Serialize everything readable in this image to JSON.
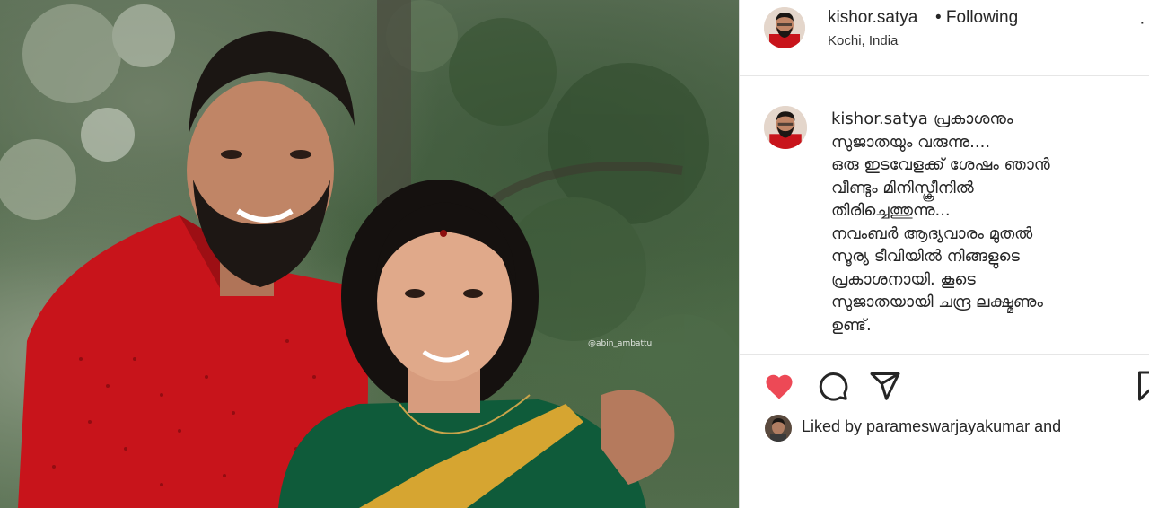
{
  "post": {
    "photo_watermark": "@abin_ambattu"
  },
  "header": {
    "username": "kishor.satya",
    "follow_status": "• Following",
    "location": "Kochi, India",
    "more_icon": "more-dots-icon"
  },
  "caption": {
    "username": "kishor.satya",
    "lines": [
      "പ്രകാശനും",
      "സുജാതയും വരുന്നു....",
      "ഒരു ഇടവേളക്ക് ശേഷം ഞാൻ",
      "വീണ്ടും മിനിസ്ക്രീനിൽ",
      "തിരിച്ചെത്തുന്നു...",
      "നവംബർ ആദ്യവാരം മുതൽ",
      "സൂര്യ ടീവിയിൽ നിങ്ങളുടെ",
      "പ്രകാശനായി. കൂടെ",
      "സുജാതയായി ചന്ദ്ര ലക്ഷ്മണും",
      "ഉണ്ട്."
    ]
  },
  "actions": {
    "like_icon": "heart-filled-icon",
    "comment_icon": "comment-icon",
    "share_icon": "share-icon",
    "save_icon": "bookmark-icon",
    "like_color": "#ed4956"
  },
  "likes": {
    "text": "Liked by parameswarjayakumar and"
  }
}
